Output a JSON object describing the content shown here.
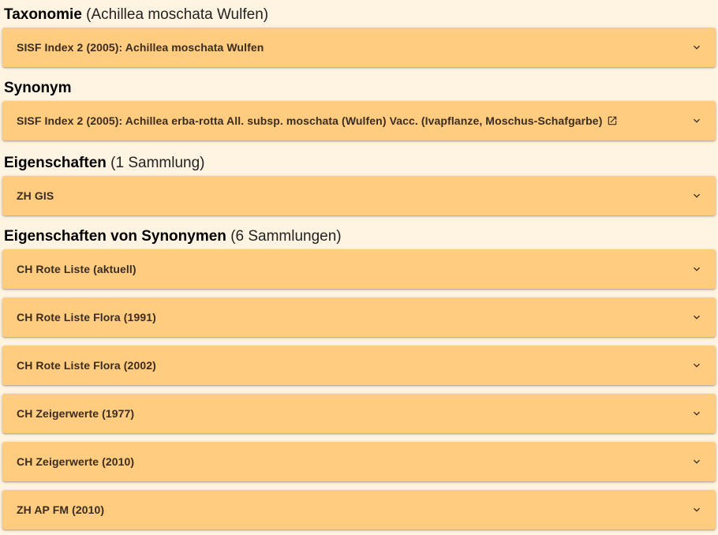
{
  "sections": [
    {
      "title": "Taxonomie",
      "suffix": "(Achillea moschata Wulfen)"
    },
    {
      "title": "Synonym",
      "suffix": ""
    },
    {
      "title": "Eigenschaften",
      "suffix": "(1 Sammlung)"
    },
    {
      "title": "Eigenschaften von Synonymen",
      "suffix": "(6 Sammlungen)"
    }
  ],
  "panels": [
    {
      "label": "SISF Index 2 (2005): Achillea moschata Wulfen"
    },
    {
      "label": "SISF Index 2 (2005): Achillea erba-rotta All. subsp. moschata (Wulfen) Vacc. (Ivapflanze, Moschus-Schafgarbe)"
    },
    {
      "label": "ZH GIS"
    },
    {
      "label": "CH Rote Liste (aktuell)"
    },
    {
      "label": "CH Rote Liste Flora (1991)"
    },
    {
      "label": "CH Rote Liste Flora (2002)"
    },
    {
      "label": "CH Zeigerwerte (1977)"
    },
    {
      "label": "CH Zeigerwerte (2010)"
    },
    {
      "label": "ZH AP FM (2010)"
    }
  ],
  "icons": {
    "expand": "chevron-down-icon",
    "external": "open-in-new-icon"
  },
  "colors": {
    "page_bg": "#fff3e1",
    "panel_bg": "#ffcc80",
    "panel_text": "#3b2c20"
  }
}
